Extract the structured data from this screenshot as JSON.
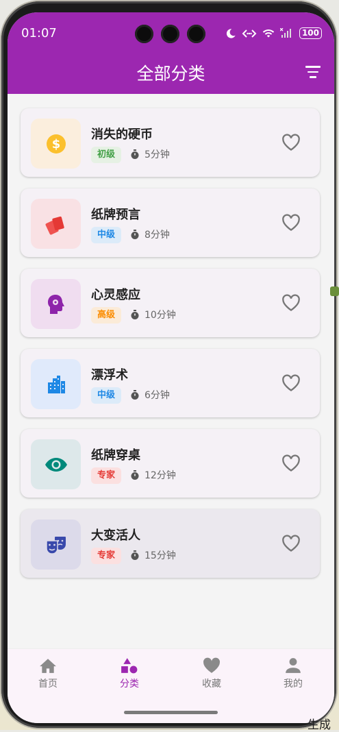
{
  "status_bar": {
    "time": "01:07",
    "battery": "100",
    "icons": [
      "moon-icon",
      "data-transfer-icon",
      "wifi-icon",
      "no-signal-icon",
      "battery-icon"
    ]
  },
  "header": {
    "title": "全部分类",
    "icon": "filter-icon"
  },
  "items": [
    {
      "name": "消失的硬币",
      "level": "初级",
      "duration": "5分钟",
      "icon": "coin-icon"
    },
    {
      "name": "纸牌预言",
      "level": "中级",
      "duration": "8分钟",
      "icon": "cards-icon"
    },
    {
      "name": "心灵感应",
      "level": "高级",
      "duration": "10分钟",
      "icon": "psychology-icon"
    },
    {
      "name": "漂浮术",
      "level": "中级",
      "duration": "6分钟",
      "icon": "city-icon"
    },
    {
      "name": "纸牌穿桌",
      "level": "专家",
      "duration": "12分钟",
      "icon": "eye-icon"
    },
    {
      "name": "大变活人",
      "level": "专家",
      "duration": "15分钟",
      "icon": "theater-masks-icon"
    }
  ],
  "level_colors": {
    "初级": {
      "bg": "#e6f1e4",
      "fg": "#43a047"
    },
    "中级": {
      "bg": "#dcebf9",
      "fg": "#1e88e5"
    },
    "高级": {
      "bg": "#fbebd8",
      "fg": "#fb8c00"
    },
    "专家": {
      "bg": "#fbe0e0",
      "fg": "#e53935"
    }
  },
  "bottom_nav": [
    {
      "label": "首页",
      "icon": "home-icon",
      "active": false
    },
    {
      "label": "分类",
      "icon": "category-icon",
      "active": true
    },
    {
      "label": "收藏",
      "icon": "heart-icon",
      "active": false
    },
    {
      "label": "我的",
      "icon": "person-icon",
      "active": false
    }
  ],
  "accent": "#9c27b0",
  "edge_text": "生成"
}
